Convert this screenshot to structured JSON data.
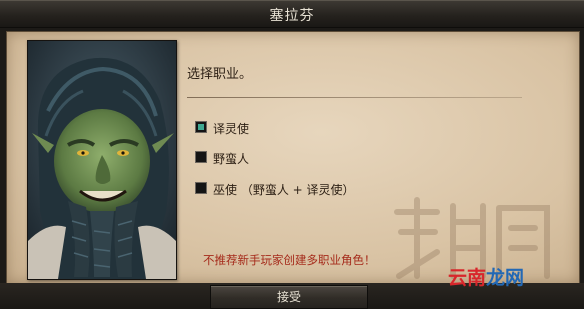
{
  "window": {
    "title": "塞拉芬"
  },
  "class_selection": {
    "prompt": "选择职业。",
    "options": [
      {
        "label": "译灵使",
        "checked": true
      },
      {
        "label": "野蛮人",
        "checked": false
      },
      {
        "label": "巫使 （野蛮人 + 译灵使）",
        "checked": false
      }
    ],
    "warning": "不推荐新手玩家创建多职业角色！"
  },
  "footer": {
    "accept_label": "接受"
  },
  "watermark": {
    "logo_part1": "云南",
    "logo_part2": "龙网"
  },
  "colors": {
    "checkbox_checked": "#3fa891",
    "warning_text": "#a52a1a",
    "logo_red": "#d8262b",
    "logo_blue": "#2268b5"
  }
}
